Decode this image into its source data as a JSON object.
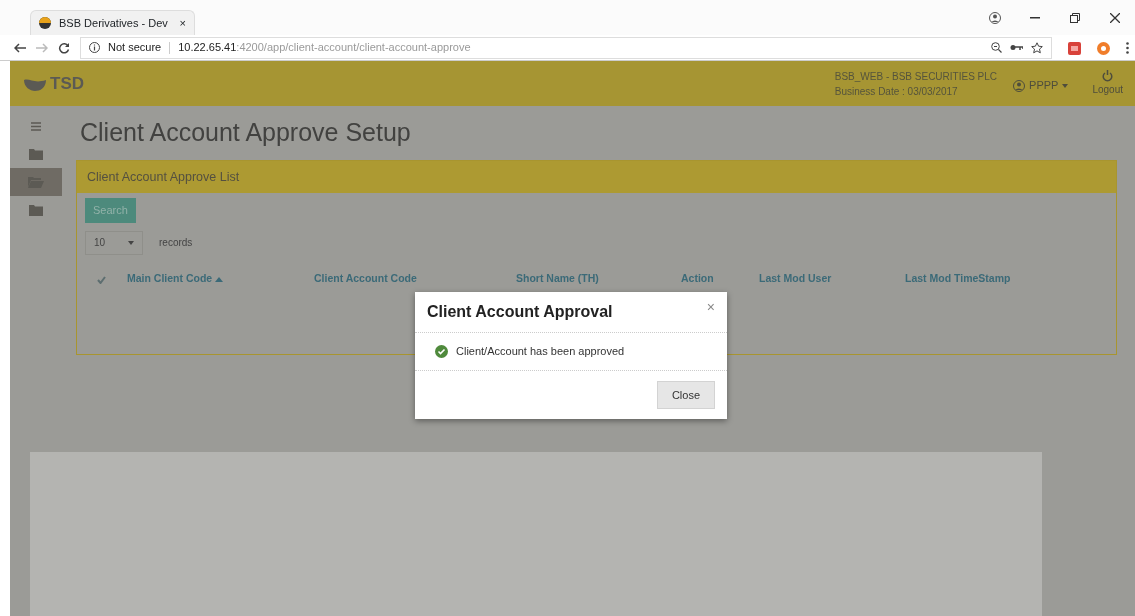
{
  "browser": {
    "tab_title": "BSB Derivatives - Dev",
    "tab_close": "×",
    "security": "Not secure",
    "host": "10.22.65.41",
    "path": ":4200/app/client-account/client-account-approve"
  },
  "header": {
    "logo": "TSD",
    "company": "BSB_WEB - BSB SECURITIES PLC",
    "business_date": "Business Date : 03/03/2017",
    "user": "PPPP",
    "logout": "Logout"
  },
  "sidebar": {
    "items": [
      {
        "kind": "menu",
        "selected": false
      },
      {
        "kind": "folder",
        "selected": false
      },
      {
        "kind": "folder-open",
        "selected": true
      },
      {
        "kind": "folder",
        "selected": false
      }
    ]
  },
  "page_title": "Client Account Approve Setup",
  "panel": {
    "title": "Client Account Approve List",
    "search_button": "Search",
    "page_size": "10",
    "records_label": "records",
    "header_checkbox": {
      "checked": true
    },
    "columns": [
      {
        "label": "Main Client Code",
        "sorted": true
      },
      {
        "label": "Client Account Code",
        "sorted": false
      },
      {
        "label": "Short Name (TH)",
        "sorted": false
      },
      {
        "label": "Action",
        "sorted": false
      },
      {
        "label": "Last Mod User",
        "sorted": false
      },
      {
        "label": "Last Mod TimeStamp",
        "sorted": false
      }
    ]
  },
  "modal": {
    "title": "Client Account Approval",
    "close_icon": "×",
    "message": "Client/Account has been approved",
    "close_button": "Close"
  }
}
